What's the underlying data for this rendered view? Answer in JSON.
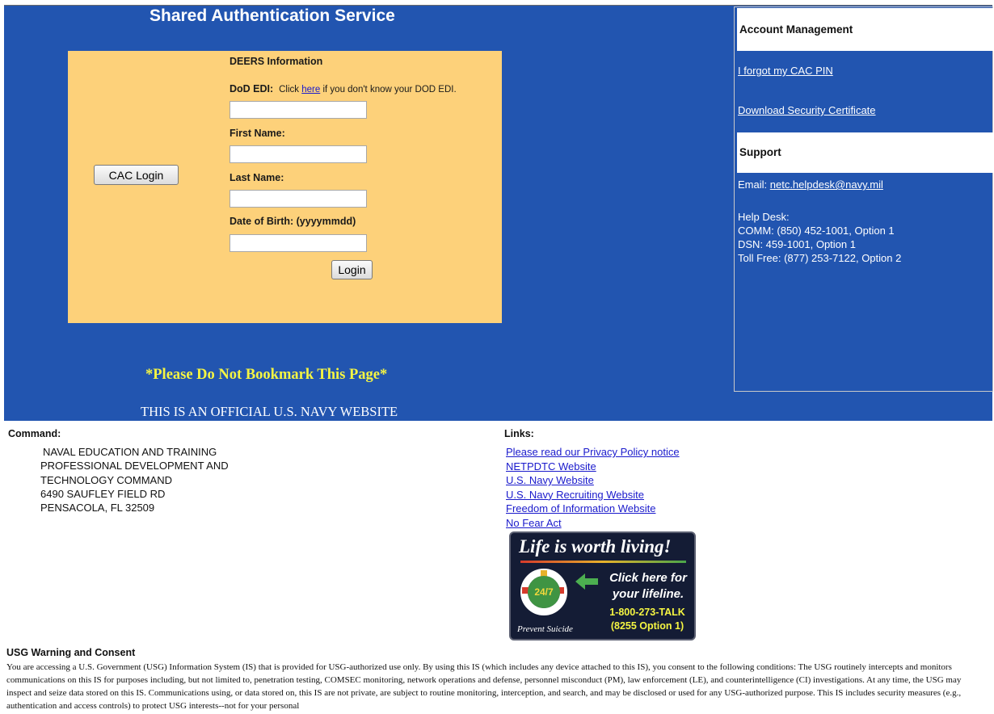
{
  "header": {
    "title": "Shared Authentication Service"
  },
  "login": {
    "cac_button": "CAC Login",
    "deers_heading": "DEERS Information",
    "edi_label": "DoD EDI:",
    "edi_hint_prefix": "Click",
    "edi_hint_link": "here",
    "edi_hint_suffix": "if you don't know your DOD EDI.",
    "edi_value": "",
    "first_name_label": "First Name:",
    "first_name_value": "",
    "last_name_label": "Last Name:",
    "last_name_value": "",
    "dob_label": "Date of Birth: (yyyymmdd)",
    "dob_value": "",
    "login_button": "Login"
  },
  "notices": {
    "bookmark": "*Please Do Not Bookmark This Page*",
    "official": "THIS IS AN OFFICIAL U.S. NAVY WEBSITE"
  },
  "sidebar": {
    "account_heading": "Account Management",
    "forgot_pin": "I forgot my CAC PIN",
    "download_cert": "Download Security Certificate",
    "support_heading": "Support",
    "email_label": "Email:",
    "email": "netc.helpdesk@navy.mil",
    "helpdesk_label": "Help Desk:",
    "comm": "COMM: (850) 452-1001, Option 1",
    "dsn": "DSN: 459-1001, Option 1",
    "tollfree": "Toll Free: (877) 253-7122, Option 2"
  },
  "command": {
    "heading": "Command:",
    "lines": [
      "NAVAL EDUCATION AND TRAINING",
      "PROFESSIONAL DEVELOPMENT AND",
      "TECHNOLOGY COMMAND",
      "6490 SAUFLEY FIELD RD",
      "PENSACOLA, FL 32509"
    ]
  },
  "links": {
    "heading": "Links:",
    "items": [
      "Please read our Privacy Policy notice",
      "NETPDTC Website",
      "U.S. Navy Website",
      "U.S. Navy Recruiting Website",
      "Freedom of Information Website",
      "No Fear Act"
    ]
  },
  "lifeline": {
    "title": "Life is worth living!",
    "ring_text": "24/7",
    "click_line1": "Click here for",
    "click_line2": "your lifeline.",
    "phone": "1-800-273-TALK",
    "option": "(8255 Option 1)",
    "prevent": "Prevent Suicide"
  },
  "usg": {
    "heading": "USG Warning and Consent",
    "body": "You are accessing a U.S. Government (USG) Information System (IS) that is provided for USG-authorized use only. By using this IS (which includes any device attached to this IS), you consent to the following conditions: The USG routinely intercepts and monitors communications on this IS for purposes including, but not limited to, penetration testing, COMSEC monitoring, network operations and defense, personnel misconduct (PM), law enforcement (LE), and counterintelligence (CI) investigations. At any time, the USG may inspect and seize data stored on this IS. Communications using, or data stored on, this IS are not private, are subject to routine monitoring, interception, and search, and may be disclosed or used for any USG-authorized purpose. This IS includes security measures (e.g., authentication and access controls) to protect USG interests--not for your personal"
  },
  "colors": {
    "header_blue": "#2255b0",
    "login_panel": "#fdd17a",
    "bookmark_text": "#f5f542",
    "link": "#1a1acc"
  }
}
